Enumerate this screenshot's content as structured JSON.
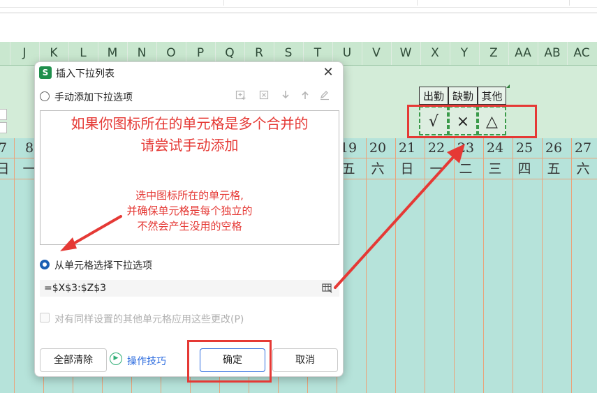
{
  "spreadsheet": {
    "columns": [
      "J",
      "K",
      "L",
      "M",
      "N",
      "O",
      "P",
      "Q",
      "R",
      "S",
      "T",
      "U",
      "V",
      "W",
      "X",
      "Y",
      "Z",
      "AA",
      "AB",
      "AC"
    ],
    "left_edge_digits": [
      "7",
      "8"
    ],
    "left_edge_weekday": [
      "日",
      "一"
    ],
    "days": [
      "19",
      "20",
      "21",
      "22",
      "23",
      "24",
      "25",
      "26",
      "27"
    ],
    "weekdays": [
      "五",
      "六",
      "日",
      "一",
      "二",
      "三",
      "四",
      "五",
      "六"
    ],
    "legend": {
      "headers": [
        "出勤",
        "缺勤",
        "其他"
      ],
      "symbols": [
        "√",
        "×",
        "△"
      ]
    }
  },
  "dialog": {
    "app_icon": "S",
    "title": "插入下拉列表",
    "option_manual": "手动添加下拉选项",
    "option_from_cells": "从单元格选择下拉选项",
    "range_value": "=$X$3:$Z$3",
    "apply_all_label": "对有同样设置的其他单元格应用这些更改(P)",
    "clear_all": "全部清除",
    "tips": "操作技巧",
    "ok": "确定",
    "cancel": "取消",
    "close_glyph": "✕"
  },
  "annotations": {
    "note_line1": "如果你图标所在的单元格是多个合并的",
    "note_line2": "请尝试手动添加",
    "tip_line1": "选中图标所在的单元格,",
    "tip_line2": "并确保单元格是每个独立的",
    "tip_line3": "不然会产生没用的空格"
  },
  "colors": {
    "accent": "#1a5fb4",
    "annotation_red": "#e53935",
    "grid_orange": "#eaa37a",
    "header_green": "#c9e7cf",
    "cell_teal": "#b6e3da"
  }
}
